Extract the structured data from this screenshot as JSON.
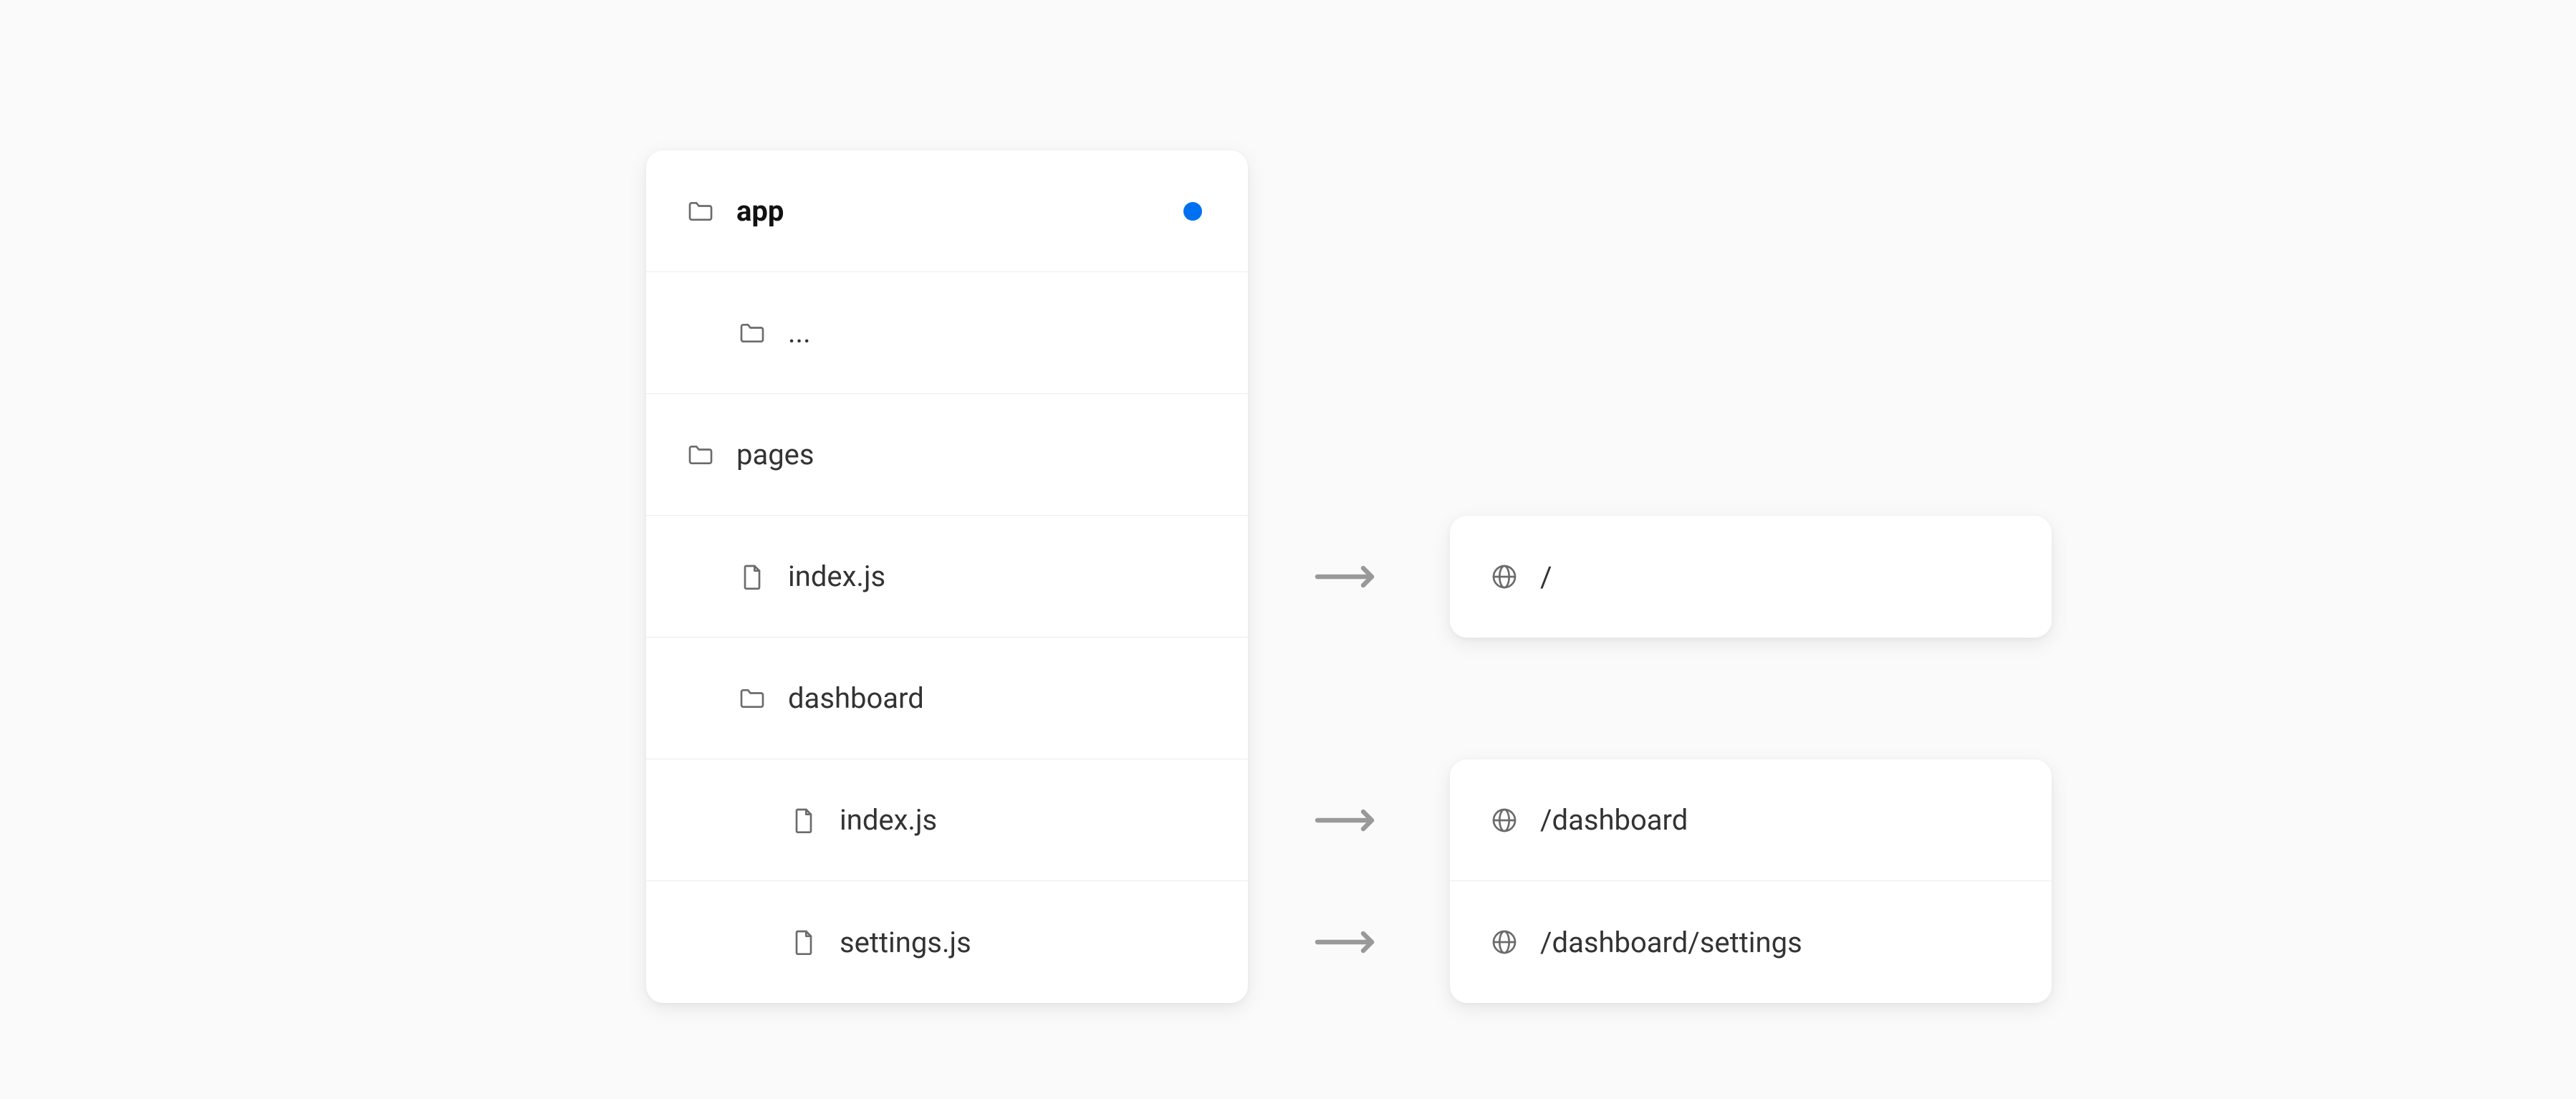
{
  "tree": {
    "items": [
      {
        "icon": "folder",
        "label": "app",
        "indent": 0,
        "bold": true,
        "dot": true
      },
      {
        "icon": "folder",
        "label": "...",
        "indent": 1,
        "bold": false,
        "dot": false
      },
      {
        "icon": "folder",
        "label": "pages",
        "indent": 0,
        "bold": false,
        "dot": false
      },
      {
        "icon": "file",
        "label": "index.js",
        "indent": 1,
        "bold": false,
        "dot": false
      },
      {
        "icon": "folder",
        "label": "dashboard",
        "indent": 1,
        "bold": false,
        "dot": false
      },
      {
        "icon": "file",
        "label": "index.js",
        "indent": 2,
        "bold": false,
        "dot": false
      },
      {
        "icon": "file",
        "label": "settings.js",
        "indent": 2,
        "bold": false,
        "dot": false
      }
    ]
  },
  "routes": {
    "card1": [
      {
        "path": "/"
      }
    ],
    "card2": [
      {
        "path": "/dashboard"
      },
      {
        "path": "/dashboard/settings"
      }
    ]
  },
  "colors": {
    "accent": "#0070f3",
    "arrow": "#999999",
    "icon": "#6b6b6b",
    "border": "#ececec",
    "bg": "#fafafa"
  }
}
